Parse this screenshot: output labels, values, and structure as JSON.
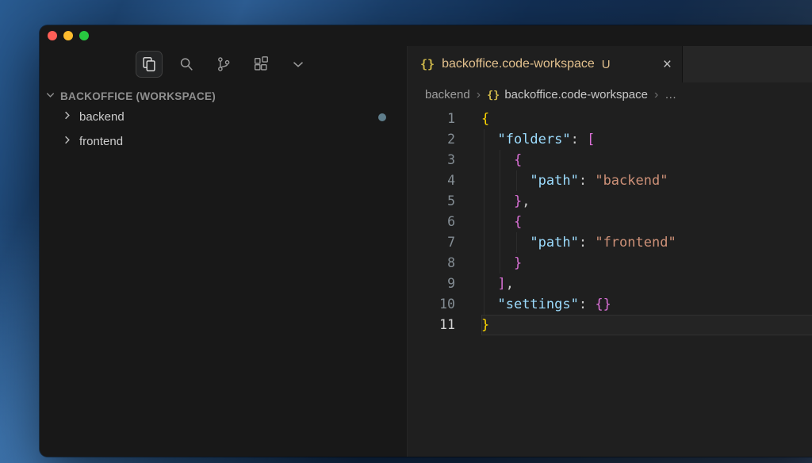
{
  "colors": {
    "file_status": "#e2c08d",
    "json_icon": "#ccb64a",
    "change_dot": "#5f7e8c",
    "syntax": {
      "brace1": "#ffd700",
      "brace2": "#da70d6",
      "brace3": "#da70d6",
      "key": "#9cdcfe",
      "string": "#ce9178",
      "punct": "#cccccc"
    }
  },
  "titlebar": {
    "traffic_lights": [
      {
        "name": "close",
        "color": "#ff5f57"
      },
      {
        "name": "minimize",
        "color": "#febc2e"
      },
      {
        "name": "zoom",
        "color": "#28c840"
      }
    ]
  },
  "activity_bar": {
    "icons": [
      {
        "name": "explorer",
        "active": true
      },
      {
        "name": "search",
        "active": false
      },
      {
        "name": "source-control",
        "active": false
      },
      {
        "name": "extensions",
        "active": false
      },
      {
        "name": "more-views",
        "active": false
      }
    ]
  },
  "sidebar": {
    "header": "BACKOFFICE (WORKSPACE)",
    "items": [
      {
        "label": "backend",
        "has_change_dot": true
      },
      {
        "label": "frontend",
        "has_change_dot": false
      }
    ]
  },
  "editor": {
    "tab": {
      "file_icon": "{}",
      "filename": "backoffice.code-workspace",
      "git_badge": "U",
      "close_glyph": "×"
    },
    "breadcrumbs": {
      "separator": "›",
      "items": [
        {
          "label": "backend"
        },
        {
          "label": "backoffice.code-workspace",
          "file_icon": "{}",
          "current": true
        },
        {
          "label": "…"
        }
      ]
    },
    "code": {
      "language": "json",
      "active_line": 11,
      "lines": [
        {
          "num": 1,
          "guides": [],
          "tokens": [
            {
              "t": "{",
              "c": "brace1"
            }
          ]
        },
        {
          "num": 2,
          "guides": [
            0
          ],
          "tokens": [
            {
              "t": "  "
            },
            {
              "t": "\"folders\"",
              "c": "key"
            },
            {
              "t": ": ",
              "c": "punct"
            },
            {
              "t": "[",
              "c": "brace2"
            }
          ]
        },
        {
          "num": 3,
          "guides": [
            0,
            2
          ],
          "tokens": [
            {
              "t": "    "
            },
            {
              "t": "{",
              "c": "brace3"
            }
          ]
        },
        {
          "num": 4,
          "guides": [
            0,
            2,
            4
          ],
          "tokens": [
            {
              "t": "      "
            },
            {
              "t": "\"path\"",
              "c": "key"
            },
            {
              "t": ": ",
              "c": "punct"
            },
            {
              "t": "\"backend\"",
              "c": "string"
            }
          ]
        },
        {
          "num": 5,
          "guides": [
            0,
            2
          ],
          "tokens": [
            {
              "t": "    "
            },
            {
              "t": "}",
              "c": "brace3"
            },
            {
              "t": ",",
              "c": "punct"
            }
          ]
        },
        {
          "num": 6,
          "guides": [
            0,
            2
          ],
          "tokens": [
            {
              "t": "    "
            },
            {
              "t": "{",
              "c": "brace3"
            }
          ]
        },
        {
          "num": 7,
          "guides": [
            0,
            2,
            4
          ],
          "tokens": [
            {
              "t": "      "
            },
            {
              "t": "\"path\"",
              "c": "key"
            },
            {
              "t": ": ",
              "c": "punct"
            },
            {
              "t": "\"frontend\"",
              "c": "string"
            }
          ]
        },
        {
          "num": 8,
          "guides": [
            0,
            2
          ],
          "tokens": [
            {
              "t": "    "
            },
            {
              "t": "}",
              "c": "brace3"
            }
          ]
        },
        {
          "num": 9,
          "guides": [
            0
          ],
          "tokens": [
            {
              "t": "  "
            },
            {
              "t": "]",
              "c": "brace2"
            },
            {
              "t": ",",
              "c": "punct"
            }
          ]
        },
        {
          "num": 10,
          "guides": [
            0
          ],
          "tokens": [
            {
              "t": "  "
            },
            {
              "t": "\"settings\"",
              "c": "key"
            },
            {
              "t": ": ",
              "c": "punct"
            },
            {
              "t": "{}",
              "c": "brace2"
            }
          ]
        },
        {
          "num": 11,
          "guides": [],
          "tokens": [
            {
              "t": "}",
              "c": "brace1"
            }
          ]
        }
      ]
    }
  }
}
